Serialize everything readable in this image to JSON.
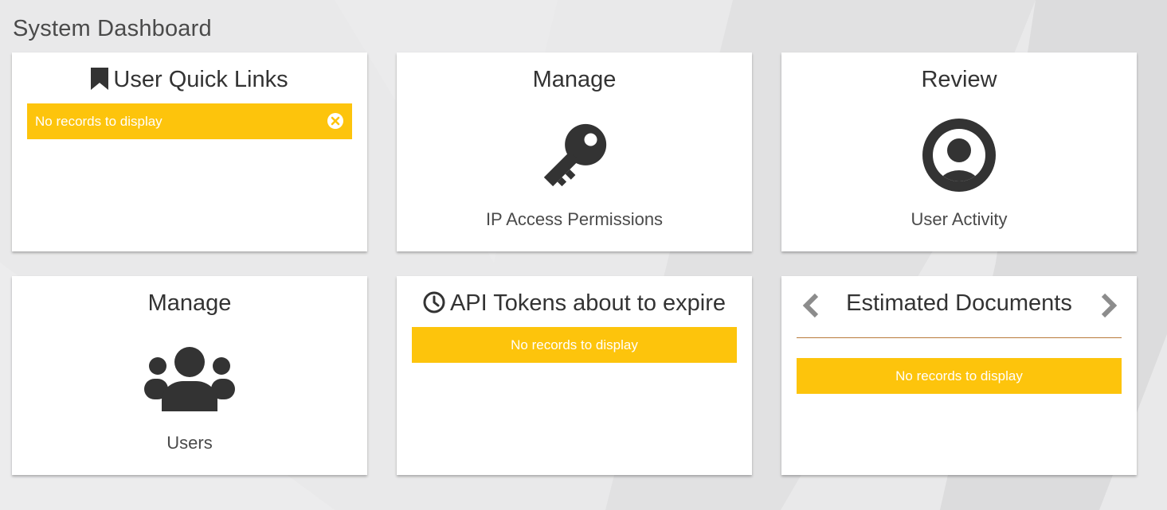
{
  "page": {
    "title": "System Dashboard"
  },
  "colors": {
    "alert_bg": "#fdc40c",
    "icon_dark": "#333333",
    "arrow_gray": "#8c8c8c",
    "divider": "#b87a3a",
    "card_bg": "#ffffff"
  },
  "cards": {
    "quick_links": {
      "title": "User Quick Links",
      "icon": "bookmark-icon",
      "alert": "No records to display",
      "close_icon": "close-circle-icon"
    },
    "ip_access": {
      "title": "Manage",
      "icon": "key-icon",
      "caption": "IP Access Permissions"
    },
    "user_activity": {
      "title": "Review",
      "icon": "user-circle-icon",
      "caption": "User Activity"
    },
    "users": {
      "title": "Manage",
      "icon": "users-group-icon",
      "caption": "Users"
    },
    "api_tokens": {
      "title": "API Tokens about to expire",
      "icon": "clock-icon",
      "alert": "No records to display"
    },
    "estimated_documents": {
      "title": "Estimated Documents",
      "prev_icon": "chevron-left-icon",
      "next_icon": "chevron-right-icon",
      "alert": "No records to display"
    }
  }
}
